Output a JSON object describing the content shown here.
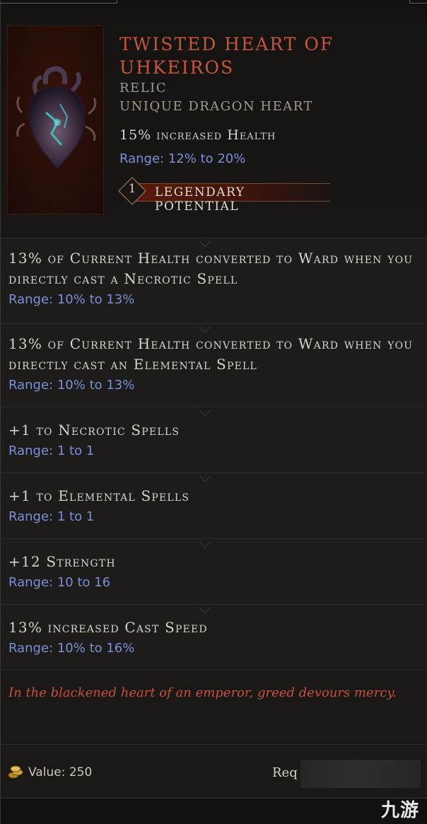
{
  "item": {
    "name": "Twisted Heart of Uhkeiros",
    "rarity": "Relic",
    "base_type": "Unique Dragon Heart",
    "implicit": "15% increased Health",
    "implicit_range": "Range: 12% to 20%",
    "legendary_potential_count": "1",
    "legendary_potential_label": "Legendary Potential"
  },
  "affixes": [
    {
      "text": "13% of Current Health converted to Ward when you directly cast a Necrotic Spell",
      "range": "Range: 10% to 13%"
    },
    {
      "text": "13% of Current Health converted to Ward when you directly cast an Elemental Spell",
      "range": "Range: 10% to 13%"
    },
    {
      "text": "+1 to Necrotic Spells",
      "range": "Range: 1 to 1"
    },
    {
      "text": "+1 to Elemental Spells",
      "range": "Range: 1 to 1"
    },
    {
      "text": "+12 Strength",
      "range": "Range: 10 to 16"
    },
    {
      "text": "13% increased Cast Speed",
      "range": "Range: 10% to 16%"
    }
  ],
  "lore": "In the blackened heart of an emperor, greed devours mercy.",
  "footer": {
    "value_label": "Value: 250",
    "requirement_label": "Req"
  },
  "watermark": "九游",
  "colors": {
    "unique_name": "#c8553a",
    "range_text": "#7b8fd6",
    "lore_text": "#c8503a",
    "affix_text": "#d8d2c8"
  },
  "icons": {
    "item_icon": "dragon-heart-icon",
    "gold_icon": "gold-coins-icon"
  }
}
